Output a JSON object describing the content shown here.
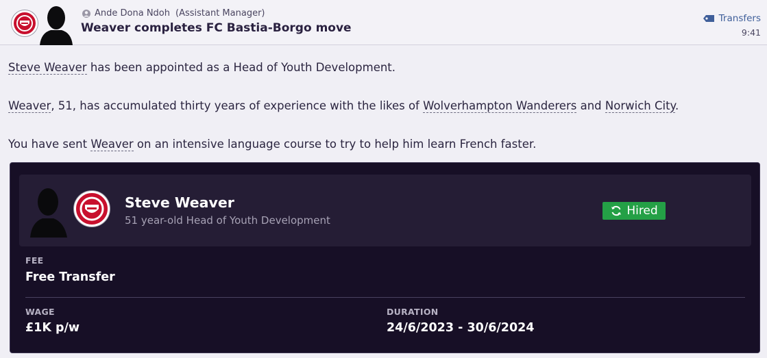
{
  "header": {
    "sender_name": "Ande Dona Ndoh",
    "sender_role": "(Assistant Manager)",
    "title": "Weaver completes FC Bastia-Borgo move",
    "category": "Transfers",
    "time": "9:41"
  },
  "message": {
    "p1": {
      "link": "Steve Weaver",
      "text": " has been appointed as a Head of Youth Development."
    },
    "p2": {
      "link1": "Weaver",
      "text1": ", 51, has accumulated thirty years of experience with the likes of ",
      "link2": "Wolverhampton Wanderers",
      "text2": " and ",
      "link3": "Norwich City",
      "text3": "."
    },
    "p3": {
      "text1": "You have sent ",
      "link": "Weaver",
      "text2": " on an intensive language course to try to help him learn French faster."
    }
  },
  "card": {
    "name": "Steve Weaver",
    "subtitle": "51 year-old Head of Youth Development",
    "status": "Hired",
    "fee_label": "FEE",
    "fee_value": "Free Transfer",
    "wage_label": "WAGE",
    "wage_value": "£1K p/w",
    "duration_label": "DURATION",
    "duration_value": "24/6/2023 - 30/6/2024"
  },
  "colors": {
    "club_red": "#c8102e",
    "hired_green": "#24a046",
    "card_bg": "#170f26",
    "link_blue": "#3f5f9a"
  },
  "icons": {
    "club": "club-crest-icon",
    "person": "person-icon",
    "category": "transfer-tag-icon",
    "status": "refresh-icon"
  }
}
